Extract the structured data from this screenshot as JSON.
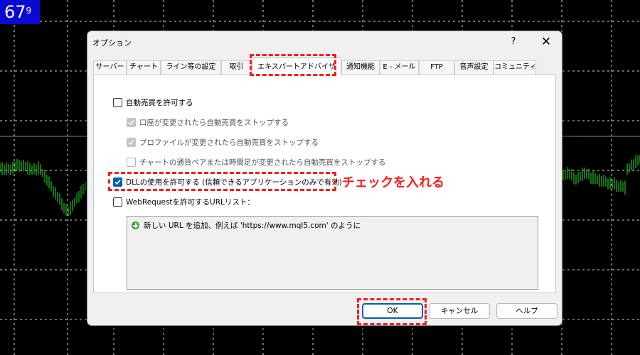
{
  "chart": {
    "price_badge": "67",
    "price_badge_sup": "9"
  },
  "dialog": {
    "title": "オプション",
    "help_label": "?",
    "close_label": "✕"
  },
  "tabs": [
    {
      "label": "サーバー"
    },
    {
      "label": "チャート"
    },
    {
      "label": "ライン等の設定"
    },
    {
      "label": "取引"
    },
    {
      "label": "エキスパートアドバイザ",
      "active": true
    },
    {
      "label": "通知機能"
    },
    {
      "label": "E - メール"
    },
    {
      "label": "FTP"
    },
    {
      "label": "音声設定"
    },
    {
      "label": "コミュニティ"
    }
  ],
  "options": {
    "auto_trading": {
      "label": "自動売買を許可する",
      "checked": false
    },
    "stop_on_account_change": {
      "label": "口座が変更されたら自動売買をストップする",
      "checked": true,
      "disabled": true
    },
    "stop_on_profile_change": {
      "label": "プロファイルが変更されたら自動売買をストップする",
      "checked": true,
      "disabled": true
    },
    "stop_on_symbol_change": {
      "label": "チャートの通貨ペアまたは時間足が変更されたら自動売買をストップする",
      "checked": false,
      "disabled": true
    },
    "allow_dll": {
      "label": "DLLの使用を許可する (信頼できるアプリケーションのみで有効)",
      "checked": true
    },
    "allow_webrequest": {
      "label": "WebRequestを許可するURLリスト：",
      "checked": false
    }
  },
  "url_list": {
    "add_item": "新しい URL を追加、例えば 'https://www.mql5.com' のように"
  },
  "buttons": {
    "ok": "OK",
    "cancel": "キャンセル",
    "help": "ヘルプ"
  },
  "annotation": {
    "text": "チェックを入れる",
    "color": "#ff1a1a"
  },
  "colors": {
    "accent": "#005fb8",
    "grid": "#ffffff",
    "candles": "#22c322",
    "badge": "#0a0ad2"
  }
}
